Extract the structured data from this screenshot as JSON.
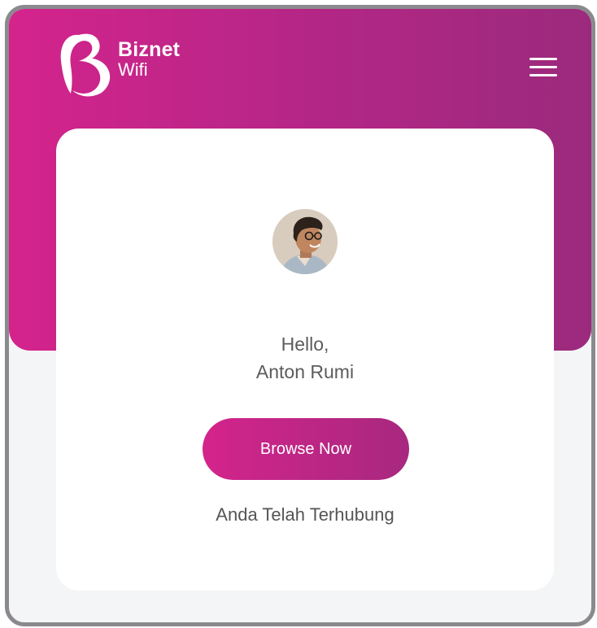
{
  "brand": {
    "name": "Biznet",
    "sub": "Wifi"
  },
  "header": {
    "menu_icon": "hamburger-menu-icon"
  },
  "user": {
    "greeting": "Hello,",
    "name": "Anton Rumi"
  },
  "actions": {
    "browse_label": "Browse Now"
  },
  "status": {
    "message": "Anda Telah Terhubung"
  },
  "colors": {
    "brand_magenta": "#d4248c",
    "brand_purple": "#9b2a7d",
    "background": "#f4f5f7"
  }
}
